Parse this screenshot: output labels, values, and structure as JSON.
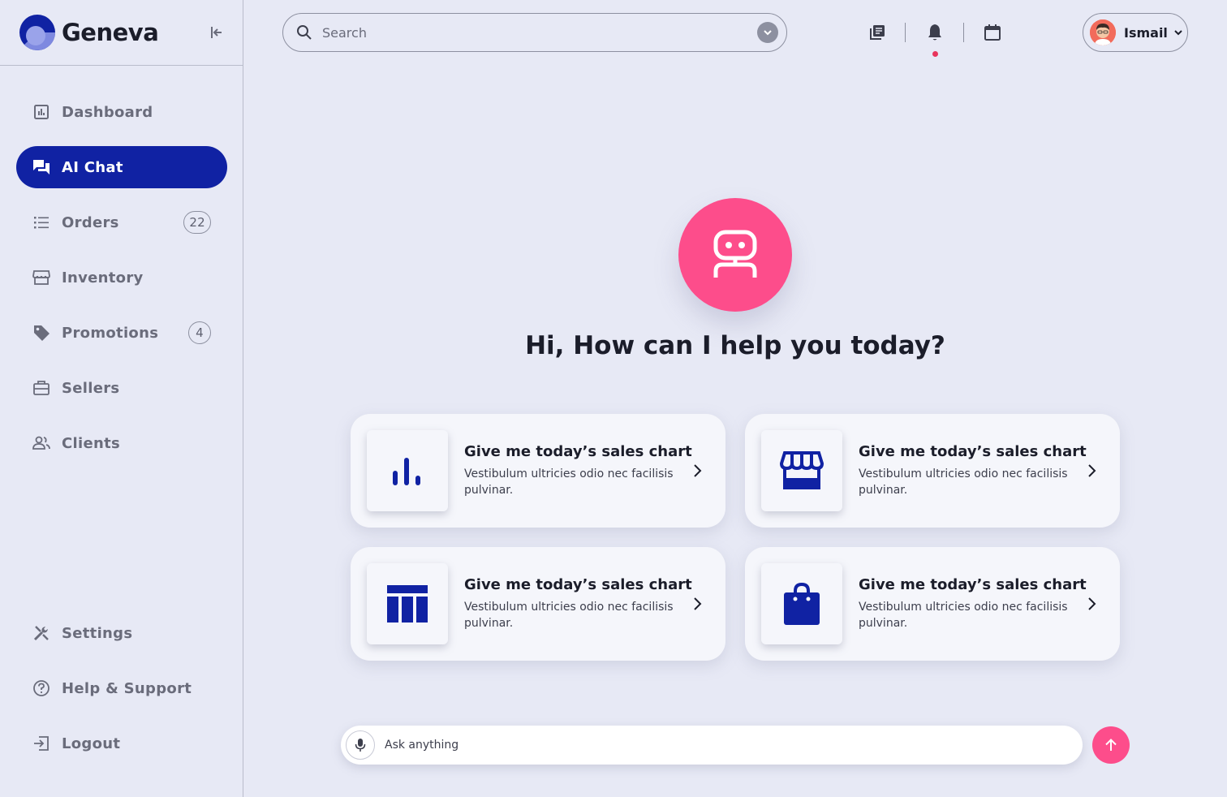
{
  "brand": {
    "name": "Geneva"
  },
  "sidebar": {
    "items": [
      {
        "label": "Dashboard",
        "icon": "chart-box-icon",
        "active": false
      },
      {
        "label": "AI Chat",
        "icon": "chat-icon",
        "active": true
      },
      {
        "label": "Orders",
        "icon": "list-icon",
        "badge": "22"
      },
      {
        "label": "Inventory",
        "icon": "store-icon"
      },
      {
        "label": "Promotions",
        "icon": "tag-icon",
        "badge": "4"
      },
      {
        "label": "Sellers",
        "icon": "briefcase-icon"
      },
      {
        "label": "Clients",
        "icon": "people-icon"
      }
    ],
    "bottom": [
      {
        "label": "Settings",
        "icon": "tools-icon"
      },
      {
        "label": "Help & Support",
        "icon": "help-icon"
      },
      {
        "label": "Logout",
        "icon": "logout-icon"
      }
    ]
  },
  "search": {
    "placeholder": "Search",
    "value": ""
  },
  "user": {
    "name": "Ismail"
  },
  "colors": {
    "accent": "#1022a3",
    "pink": "#fd4d8b",
    "background": "#e7e9f5"
  },
  "main": {
    "greeting": "Hi, How can I help you today?",
    "cards": [
      {
        "title": "Give me today’s sales chart",
        "description": "Vestibulum ultricies odio nec facilisis pulvinar.",
        "icon": "bar-chart-icon"
      },
      {
        "title": "Give me today’s sales chart",
        "description": "Vestibulum ultricies odio nec facilisis pulvinar.",
        "icon": "storefront-icon"
      },
      {
        "title": "Give me today’s sales chart",
        "description": "Vestibulum ultricies odio nec facilisis pulvinar.",
        "icon": "table-icon"
      },
      {
        "title": "Give me today’s sales chart",
        "description": "Vestibulum ultricies odio nec facilisis pulvinar.",
        "icon": "shopping-bag-icon"
      }
    ]
  },
  "composer": {
    "placeholder": "Ask anything",
    "value": ""
  }
}
